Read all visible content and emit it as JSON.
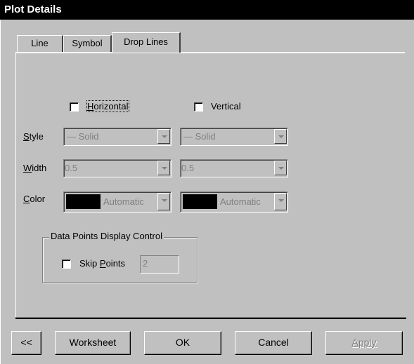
{
  "window": {
    "title": "Plot Details"
  },
  "tabs": [
    {
      "label": "Line",
      "active": false
    },
    {
      "label": "Symbol",
      "active": false
    },
    {
      "label": "Drop Lines",
      "active": true
    }
  ],
  "drop_lines": {
    "horizontal": {
      "label": "Horizontal",
      "checked": false
    },
    "vertical": {
      "label": "Vertical",
      "checked": false
    },
    "style": {
      "label": "Style",
      "left_value": "— Solid",
      "right_value": "— Solid"
    },
    "width": {
      "label": "Width",
      "left_value": "0.5",
      "right_value": "0.5"
    },
    "color": {
      "label": "Color",
      "left_value": "Automatic",
      "right_value": "Automatic",
      "swatch": "#000000"
    }
  },
  "data_points": {
    "title": "Data Points Display Control",
    "skip_points": {
      "label": "Skip Points",
      "checked": false,
      "value": "2"
    }
  },
  "buttons": {
    "back": "<<",
    "worksheet": "Worksheet",
    "ok": "OK",
    "cancel": "Cancel",
    "apply": "Apply"
  }
}
